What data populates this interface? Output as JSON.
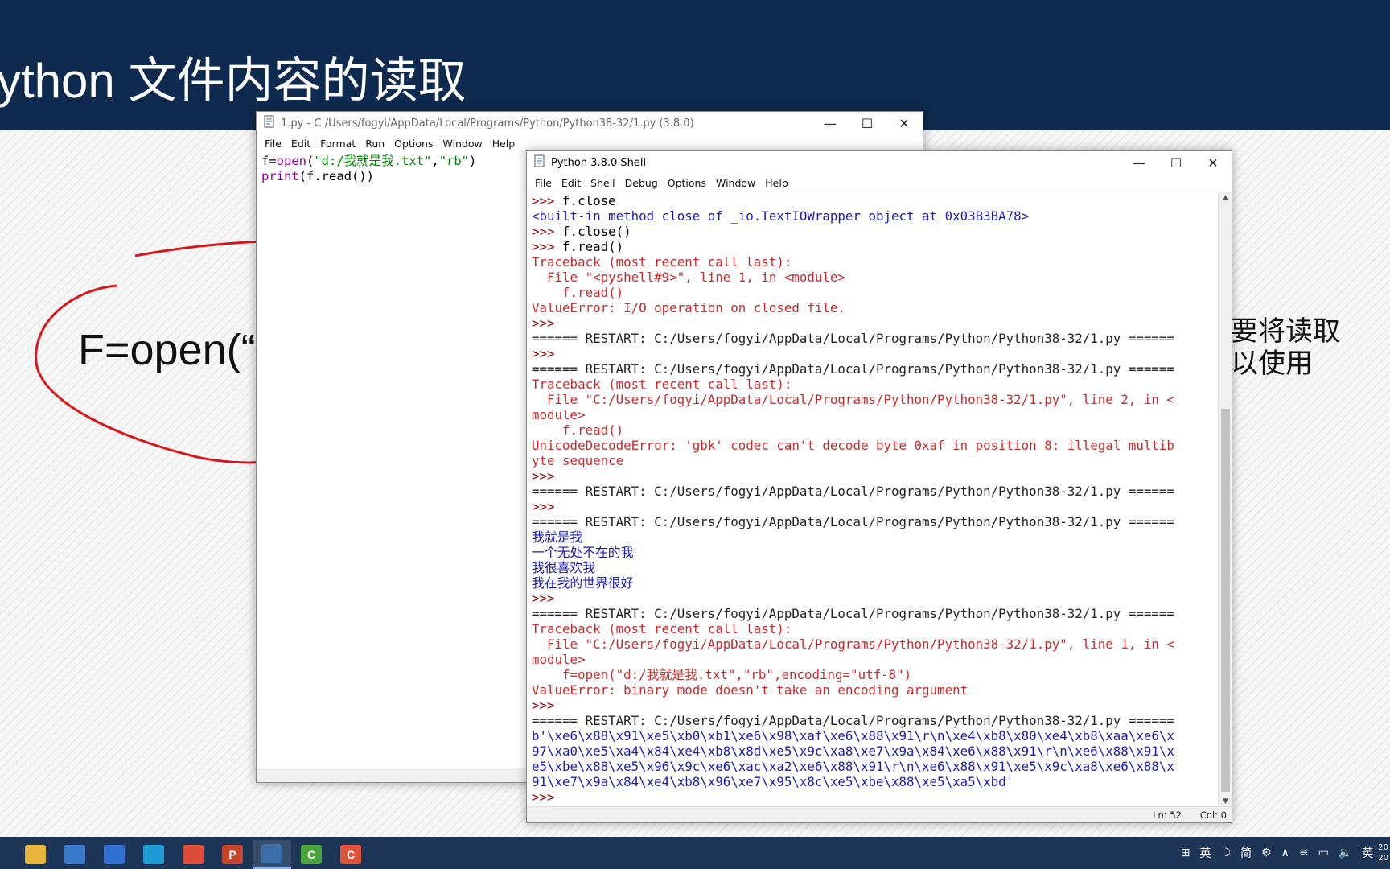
{
  "slide": {
    "title": "ython 文件内容的读取",
    "code_fragment": "F=open(“",
    "side_line_1": "要将读取",
    "side_line_2": "以使用"
  },
  "editor": {
    "title": "1.py - C:/Users/fogyi/AppData/Local/Programs/Python/Python38-32/1.py (3.8.0)",
    "menu": [
      "File",
      "Edit",
      "Format",
      "Run",
      "Options",
      "Window",
      "Help"
    ],
    "code": [
      [
        {
          "t": "f=",
          "c": "black"
        },
        {
          "t": "open",
          "c": "purple"
        },
        {
          "t": "(",
          "c": "black"
        },
        {
          "t": "\"d:/我就是我.txt\"",
          "c": "green"
        },
        {
          "t": ",",
          "c": "black"
        },
        {
          "t": "\"rb\"",
          "c": "green"
        },
        {
          "t": ")",
          "c": "black"
        }
      ],
      [
        {
          "t": "print",
          "c": "purple"
        },
        {
          "t": "(f.read())",
          "c": "black"
        }
      ]
    ]
  },
  "shell": {
    "title": "Python 3.8.0 Shell",
    "menu": [
      "File",
      "Edit",
      "Shell",
      "Debug",
      "Options",
      "Window",
      "Help"
    ],
    "lines": [
      {
        "p": ">>> ",
        "t": "f.close",
        "c": "black"
      },
      {
        "p": "",
        "t": "<built-in method close of _io.TextIOWrapper object at 0x03B3BA78>",
        "c": "blue"
      },
      {
        "p": ">>> ",
        "t": "f.close()",
        "c": "black"
      },
      {
        "p": ">>> ",
        "t": "f.read()",
        "c": "black"
      },
      {
        "p": "",
        "t": "Traceback (most recent call last):",
        "c": "red"
      },
      {
        "p": "",
        "t": "  File \"<pyshell#9>\", line 1, in <module>",
        "c": "red"
      },
      {
        "p": "",
        "t": "    f.read()",
        "c": "red"
      },
      {
        "p": "",
        "t": "ValueError: I/O operation on closed file.",
        "c": "red"
      },
      {
        "p": ">>> ",
        "t": "",
        "c": "black"
      },
      {
        "p": "",
        "t": "====== RESTART: C:/Users/fogyi/AppData/Local/Programs/Python/Python38-32/1.py ======",
        "c": "dark"
      },
      {
        "p": ">>> ",
        "t": "",
        "c": "black"
      },
      {
        "p": "",
        "t": "====== RESTART: C:/Users/fogyi/AppData/Local/Programs/Python/Python38-32/1.py ======",
        "c": "dark"
      },
      {
        "p": "",
        "t": "Traceback (most recent call last):",
        "c": "red"
      },
      {
        "p": "",
        "t": "  File \"C:/Users/fogyi/AppData/Local/Programs/Python/Python38-32/1.py\", line 2, in <",
        "c": "red"
      },
      {
        "p": "",
        "t": "module>",
        "c": "red"
      },
      {
        "p": "",
        "t": "    f.read()",
        "c": "red"
      },
      {
        "p": "",
        "t": "UnicodeDecodeError: 'gbk' codec can't decode byte 0xaf in position 8: illegal multib",
        "c": "red"
      },
      {
        "p": "",
        "t": "yte sequence",
        "c": "red"
      },
      {
        "p": ">>> ",
        "t": "",
        "c": "black"
      },
      {
        "p": "",
        "t": "====== RESTART: C:/Users/fogyi/AppData/Local/Programs/Python/Python38-32/1.py ======",
        "c": "dark"
      },
      {
        "p": ">>> ",
        "t": "",
        "c": "black"
      },
      {
        "p": "",
        "t": "====== RESTART: C:/Users/fogyi/AppData/Local/Programs/Python/Python38-32/1.py ======",
        "c": "dark"
      },
      {
        "p": "",
        "t": "我就是我",
        "c": "blue"
      },
      {
        "p": "",
        "t": "一个无处不在的我",
        "c": "blue"
      },
      {
        "p": "",
        "t": "我很喜欢我",
        "c": "blue"
      },
      {
        "p": "",
        "t": "我在我的世界很好",
        "c": "blue"
      },
      {
        "p": ">>> ",
        "t": "",
        "c": "black"
      },
      {
        "p": "",
        "t": "====== RESTART: C:/Users/fogyi/AppData/Local/Programs/Python/Python38-32/1.py ======",
        "c": "dark"
      },
      {
        "p": "",
        "t": "Traceback (most recent call last):",
        "c": "red"
      },
      {
        "p": "",
        "t": "  File \"C:/Users/fogyi/AppData/Local/Programs/Python/Python38-32/1.py\", line 1, in <",
        "c": "red"
      },
      {
        "p": "",
        "t": "module>",
        "c": "red"
      },
      {
        "p": "",
        "t": "    f=open(\"d:/我就是我.txt\",\"rb\",encoding=\"utf-8\")",
        "c": "red"
      },
      {
        "p": "",
        "t": "ValueError: binary mode doesn't take an encoding argument",
        "c": "red"
      },
      {
        "p": ">>> ",
        "t": "",
        "c": "black"
      },
      {
        "p": "",
        "t": "====== RESTART: C:/Users/fogyi/AppData/Local/Programs/Python/Python38-32/1.py ======",
        "c": "dark"
      },
      {
        "p": "",
        "t": "b'\\xe6\\x88\\x91\\xe5\\xb0\\xb1\\xe6\\x98\\xaf\\xe6\\x88\\x91\\r\\n\\xe4\\xb8\\x80\\xe4\\xb8\\xaa\\xe6\\x",
        "c": "blue"
      },
      {
        "p": "",
        "t": "97\\xa0\\xe5\\xa4\\x84\\xe4\\xb8\\x8d\\xe5\\x9c\\xa8\\xe7\\x9a\\x84\\xe6\\x88\\x91\\r\\n\\xe6\\x88\\x91\\x",
        "c": "blue"
      },
      {
        "p": "",
        "t": "e5\\xbe\\x88\\xe5\\x96\\x9c\\xe6\\xac\\xa2\\xe6\\x88\\x91\\r\\n\\xe6\\x88\\x91\\xe5\\x9c\\xa8\\xe6\\x88\\x",
        "c": "blue"
      },
      {
        "p": "",
        "t": "91\\xe7\\x9a\\x84\\xe4\\xb8\\x96\\xe7\\x95\\x8c\\xe5\\xbe\\x88\\xe5\\xa5\\xbd'",
        "c": "blue"
      },
      {
        "p": ">>> ",
        "t": "",
        "c": "black"
      }
    ],
    "status": {
      "ln": "Ln: 52",
      "col": "Col: 0"
    }
  },
  "colors": {
    "header_bg": "#0f2a4f",
    "taskbar_bg": "#1d3557",
    "idle_prompt": "#8a0000",
    "idle_output": "#1a1ab0",
    "idle_error": "#c92a2a",
    "idle_keyword": "#900090",
    "idle_string": "#008000"
  },
  "taskbar": {
    "apps": [
      {
        "name": "file-explorer-icon",
        "glyph": "",
        "color": "#e8b53a"
      },
      {
        "name": "store-icon",
        "glyph": "",
        "color": "#3a78c9"
      },
      {
        "name": "mail-icon",
        "glyph": "",
        "color": "#2f6fd1"
      },
      {
        "name": "edge-icon",
        "glyph": "",
        "color": "#1f9bd6"
      },
      {
        "name": "chrome-icon",
        "glyph": "",
        "color": "#dd4b39"
      },
      {
        "name": "powerpoint-icon",
        "glyph": "P",
        "color": "#c5432b"
      },
      {
        "name": "python-idle-icon",
        "glyph": "",
        "color": "#3b6ea8",
        "active": true
      },
      {
        "name": "camtasia-green-icon",
        "glyph": "C",
        "color": "#4aa33c"
      },
      {
        "name": "camtasia-red-icon",
        "glyph": "C",
        "color": "#e0533b"
      }
    ],
    "tray": {
      "ime": "英",
      "moon": "☽",
      "simplified": "简",
      "lang": "英",
      "clock_1": "20",
      "clock_2": "20"
    }
  }
}
